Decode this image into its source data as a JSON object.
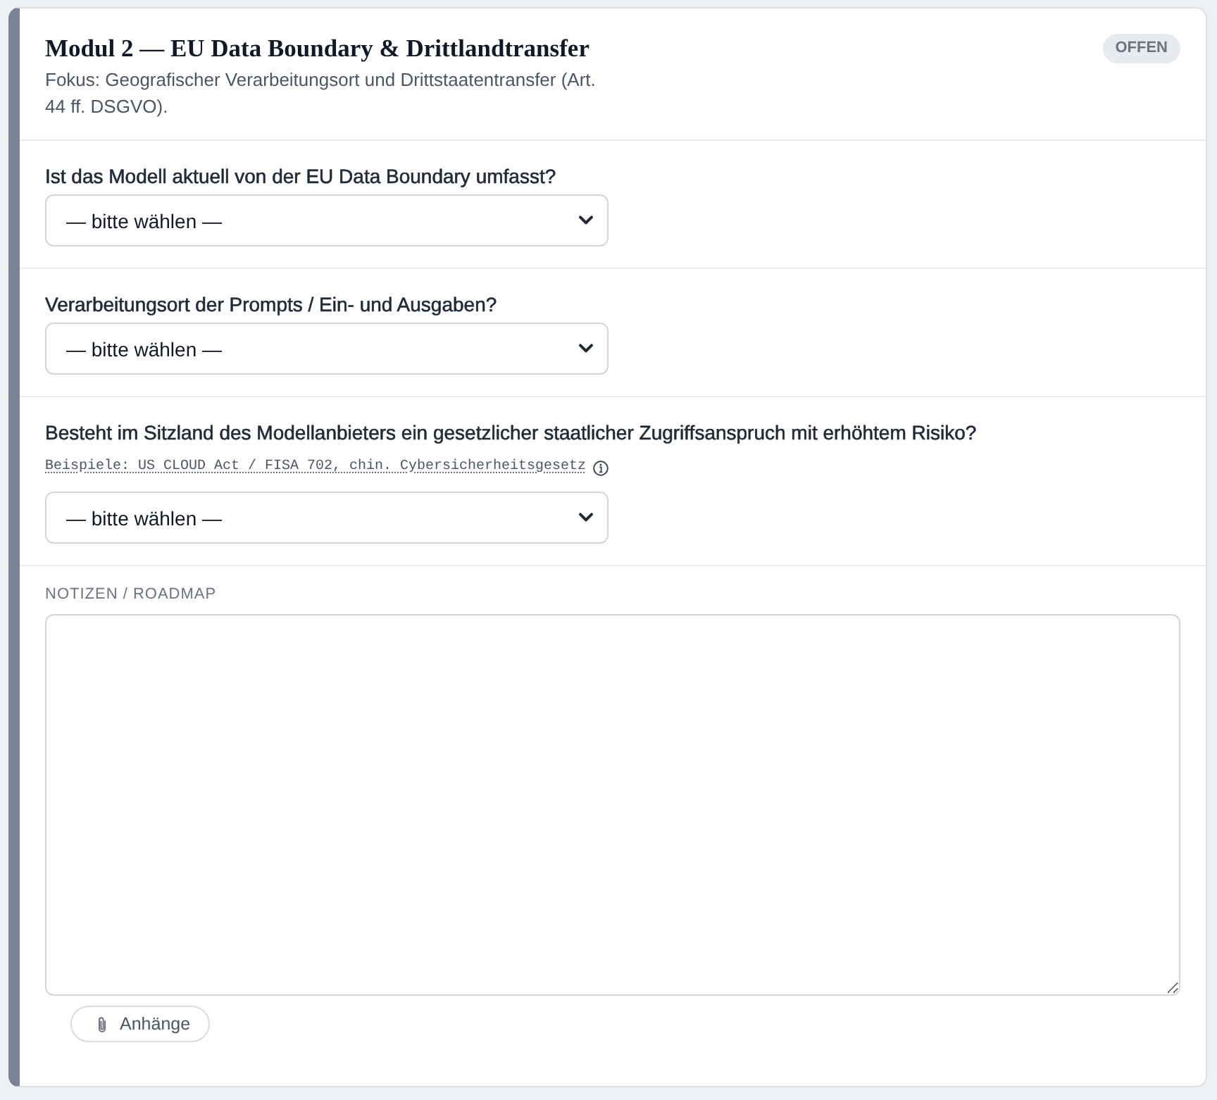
{
  "module": {
    "title": "Modul 2 — EU Data Boundary & Drittlandtransfer",
    "subtitle": "Fokus: Geografischer Verarbeitungsort und Drittstaatentransfer (Art. 44 ff. DSGVO).",
    "status": "OFFEN"
  },
  "questions": [
    {
      "label": "Ist das Modell aktuell von der EU Data Boundary umfasst?",
      "value": "— bitte wählen —"
    },
    {
      "label": "Verarbeitungsort der Prompts / Ein- und Ausgaben?",
      "value": "— bitte wählen —"
    },
    {
      "label": "Besteht im Sitzland des Modellanbieters ein gesetzlicher staatlicher Zugriffsanspruch mit erhöhtem Risiko?",
      "hint": "Beispiele: US CLOUD Act / FISA 702, chin. Cybersicherheitsgesetz",
      "value": "— bitte wählen —"
    }
  ],
  "notes": {
    "label": "NOTIZEN / ROADMAP"
  },
  "attachments_button": {
    "label": "Anhänge"
  }
}
